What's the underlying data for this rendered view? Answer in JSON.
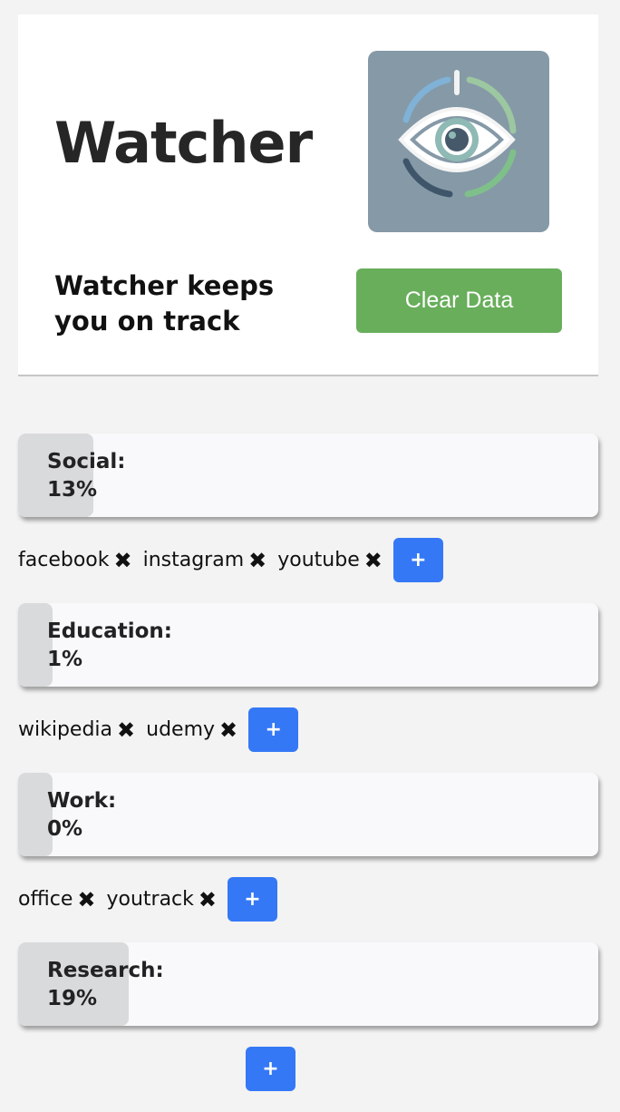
{
  "header": {
    "title": "Watcher",
    "tagline": "Watcher keeps you on track",
    "clear_button": "Clear Data"
  },
  "colors": {
    "background": "#f3f3f3",
    "clear_button": "#68ae5b",
    "add_button": "#3478f6",
    "logo_bg": "#8599a7"
  },
  "icons": {
    "remove": "heavy-multiplication-x",
    "add": "plus",
    "logo": "eye-power-icon"
  },
  "categories": [
    {
      "label": "Social:",
      "percent_text": "13%",
      "percent": 13,
      "sites": [
        "facebook",
        "instagram",
        "youtube"
      ],
      "add_label": "+"
    },
    {
      "label": "Education:",
      "percent_text": "1%",
      "percent": 1,
      "sites": [
        "wikipedia",
        "udemy"
      ],
      "add_label": "+"
    },
    {
      "label": "Work:",
      "percent_text": "0%",
      "percent": 0,
      "sites": [
        "office",
        "youtrack"
      ],
      "add_label": "+"
    },
    {
      "label": "Research:",
      "percent_text": "19%",
      "percent": 19,
      "sites": [],
      "add_label": "+"
    }
  ],
  "remove_glyph": "✖"
}
